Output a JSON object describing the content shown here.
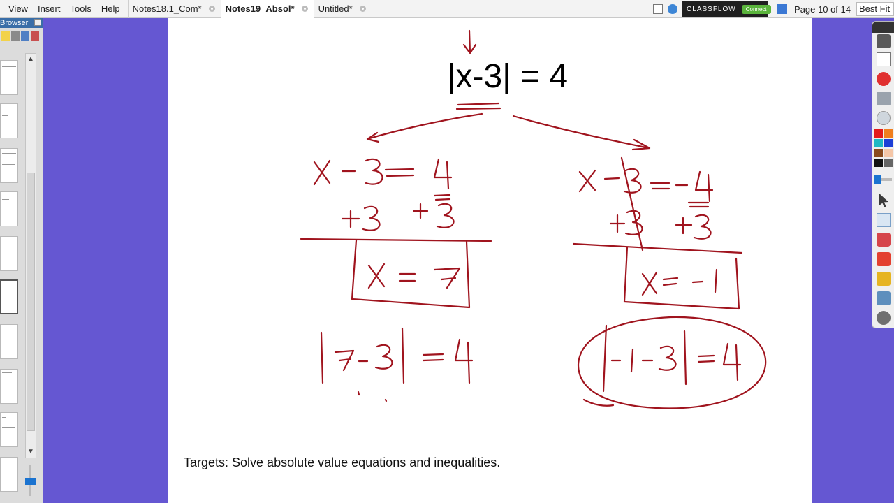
{
  "menu": {
    "items": [
      "View",
      "Insert",
      "Tools",
      "Help"
    ]
  },
  "tabs": [
    {
      "label": "Notes18.1_Com*",
      "active": false
    },
    {
      "label": "Notes19_Absol*",
      "active": true
    },
    {
      "label": "Untitled*",
      "active": false
    }
  ],
  "header": {
    "classflow_label": "CLASSFLOW",
    "connect_label": "Connect",
    "page_indicator": "Page 10 of 14",
    "fit_option": "Best Fit"
  },
  "browser": {
    "title": "Browser"
  },
  "page": {
    "equation": "|x-3| = 4",
    "targets": "Targets: Solve absolute value equations and inequalities."
  },
  "colors": {
    "background": "#6557d2",
    "ink": "#a0141e",
    "palette": [
      "#e31b1b",
      "#f07f1f",
      "#1fb8c4",
      "#1d3fd6",
      "#8a4b1e",
      "#f5c7a8",
      "#111111",
      "#666666"
    ]
  },
  "icons": {
    "toolbar": [
      "resize-icon",
      "flipchart-icon",
      "stop-icon",
      "print-icon",
      "play-icon",
      "select-icon",
      "pen-icon",
      "eraser-icon",
      "shape-icon",
      "fill-icon",
      "spotlight-icon",
      "undo-icon"
    ]
  }
}
